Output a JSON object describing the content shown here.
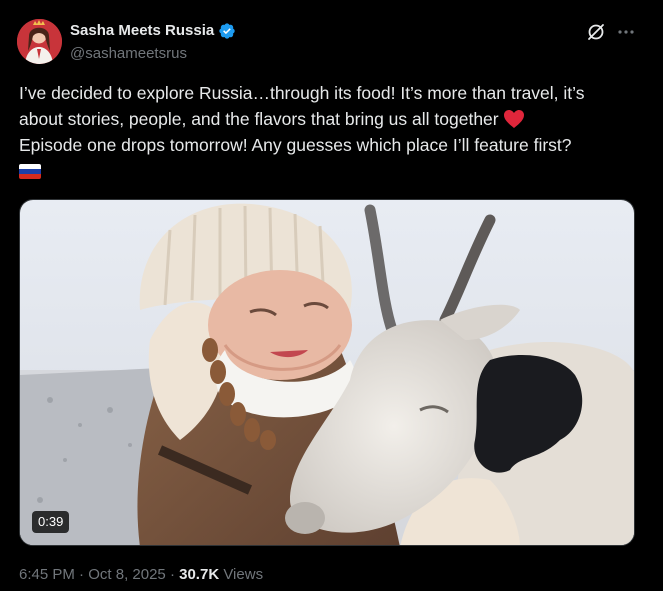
{
  "author": {
    "display_name": "Sasha Meets Russia",
    "handle": "@sashameetsrus",
    "verified": true
  },
  "icons": {
    "verified": "verified-badge-icon",
    "grok": "grok-icon",
    "more": "more-options-icon",
    "heart": "red-heart-emoji",
    "flag": "russia-flag-emoji"
  },
  "tweet": {
    "line1": "I’ve decided to explore Russia…through its food! It’s more than travel, it’s",
    "line2": "about stories, people, and the flavors that bring us all together ",
    "line3": "Episode one drops tomorrow! Any guesses which place I’ll feature first?"
  },
  "media": {
    "type": "video",
    "duration": "0:39"
  },
  "meta": {
    "time": "6:45 PM",
    "separator": " · ",
    "date": "Oct 8, 2025",
    "views_count": "30.7K",
    "views_label": " Views"
  },
  "colors": {
    "background": "#000000",
    "text": "#e7e9ea",
    "muted": "#71767b",
    "verified_blue": "#1d9bf0",
    "heart_red": "#e0263b"
  }
}
